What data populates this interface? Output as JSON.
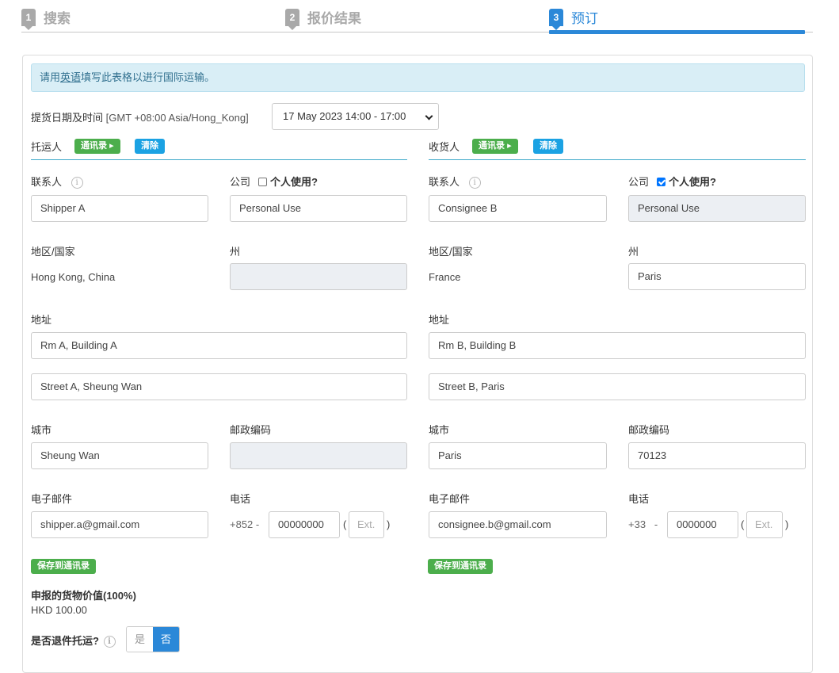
{
  "steps": [
    {
      "num": "1",
      "label": "搜索"
    },
    {
      "num": "2",
      "label": "报价结果"
    },
    {
      "num": "3",
      "label": "预订"
    }
  ],
  "notice": {
    "prefix": "请用",
    "link": "英语",
    "suffix": "填写此表格以进行国际运输。"
  },
  "pickup": {
    "label": "提货日期及时间",
    "tz": "[GMT +08:00 Asia/Hong_Kong]",
    "selected": "17 May 2023 14:00 - 17:00"
  },
  "shipper": {
    "title": "托运人",
    "address_book": "通讯录",
    "clear": "清除",
    "contact_label": "联系人",
    "contact": "Shipper A",
    "company_label": "公司",
    "personal_label": "个人使用?",
    "personal_checked": false,
    "company": "Personal Use",
    "country_label": "地区/国家",
    "country": "Hong Kong, China",
    "state_label": "州",
    "state": "",
    "address_label": "地址",
    "address1": "Rm A, Building A",
    "address2": "Street A, Sheung Wan",
    "city_label": "城市",
    "city": "Sheung Wan",
    "postal_label": "邮政编码",
    "postal": "",
    "email_label": "电子邮件",
    "email": "shipper.a@gmail.com",
    "phone_label": "电话",
    "phone_code": "+852",
    "phone": "00000000",
    "ext_placeholder": "Ext.",
    "save": "保存到通讯录"
  },
  "consignee": {
    "title": "收货人",
    "address_book": "通讯录",
    "clear": "清除",
    "contact_label": "联系人",
    "contact": "Consignee B",
    "company_label": "公司",
    "personal_label": "个人使用?",
    "personal_checked": true,
    "company": "Personal Use",
    "country_label": "地区/国家",
    "country": "France",
    "state_label": "州",
    "state": "Paris",
    "address_label": "地址",
    "address1": "Rm B, Building B",
    "address2": "Street B, Paris",
    "city_label": "城市",
    "city": "Paris",
    "postal_label": "邮政编码",
    "postal": "70123",
    "email_label": "电子邮件",
    "email": "consignee.b@gmail.com",
    "phone_label": "电话",
    "phone_code": "+33",
    "phone": "0000000",
    "ext_placeholder": "Ext.",
    "save": "保存到通讯录"
  },
  "declared": {
    "label": "申报的货物价值(100%)",
    "value": "HKD 100.00"
  },
  "return": {
    "label": "是否退件托运?",
    "yes": "是",
    "no": "否",
    "selected": "no"
  },
  "colors": {
    "accent": "#2b88d8",
    "green": "#4cae4c",
    "blue": "#1ba2e3"
  }
}
